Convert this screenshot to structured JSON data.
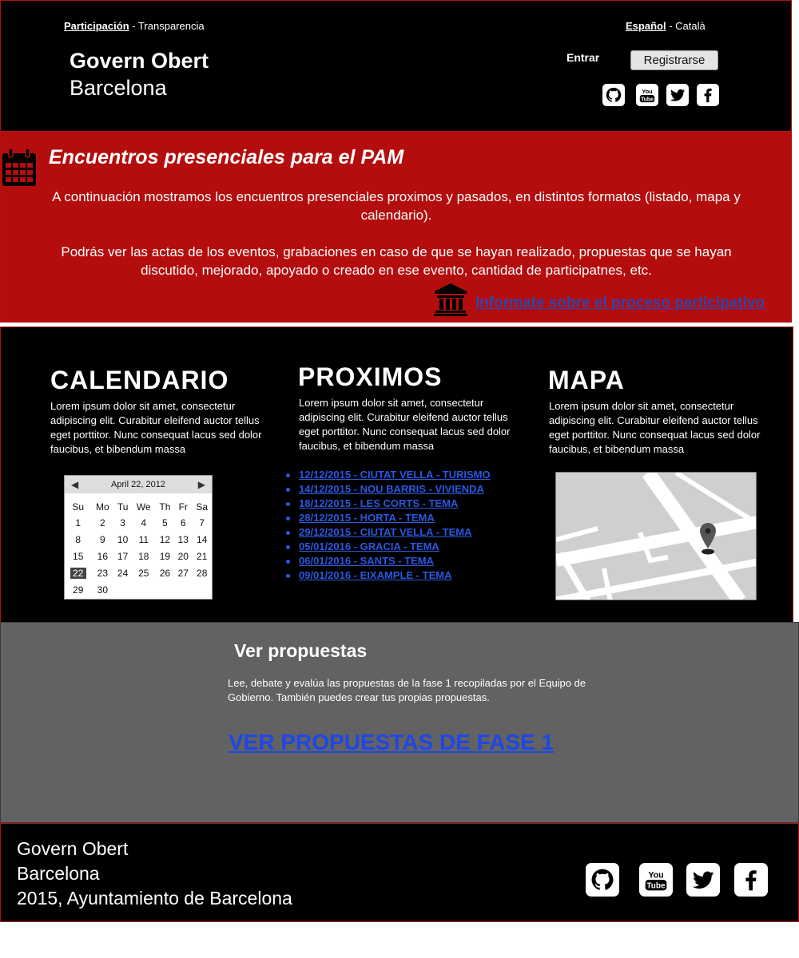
{
  "header": {
    "nav_left": {
      "active": "Participación",
      "separator": " - ",
      "other": "Transparencia"
    },
    "nav_right": {
      "active": "Español",
      "separator": " - ",
      "other": "Català"
    },
    "brand_line1": "Govern Obert",
    "brand_line2": "Barcelona",
    "login_label": "Entrar",
    "register_label": "Registrarse",
    "social_icons": [
      "github-icon",
      "youtube-icon",
      "twitter-icon",
      "facebook-icon"
    ]
  },
  "banner": {
    "title": "Encuentros presenciales para el PAM",
    "paragraph1": "A continuación mostramos los encuentros presenciales proximos y pasados, en distintos formatos (listado, mapa y calendario).",
    "paragraph2": "Podrás ver las actas de los eventos, grabaciones en caso de que se hayan realizado, propuestas que se hayan discutido, mejorado, apoyado o creado en ese evento, cantidad de participatnes, etc.",
    "link_label": "Informate sobre el proceso participativo",
    "background_color": "#b40d0d"
  },
  "calendar_col": {
    "title": "CALENDARIO",
    "text": "Lorem ipsum dolor sit amet, consectetur adipiscing elit. Curabitur eleifend auctor tellus eget porttitor. Nunc consequat lacus sed dolor faucibus, et bibendum massa",
    "widget": {
      "month_label": "April 22, 2012",
      "prev": "◀",
      "next": "▶",
      "weekdays": [
        "Su",
        "Mo",
        "Tu",
        "We",
        "Th",
        "Fr",
        "Sa"
      ],
      "weeks": [
        [
          "1",
          "2",
          "3",
          "4",
          "5",
          "6",
          "7"
        ],
        [
          "8",
          "9",
          "10",
          "11",
          "12",
          "13",
          "14"
        ],
        [
          "15",
          "16",
          "17",
          "18",
          "19",
          "20",
          "21"
        ],
        [
          "22",
          "23",
          "24",
          "25",
          "26",
          "27",
          "28"
        ],
        [
          "29",
          "30",
          "",
          "",
          "",
          "",
          ""
        ]
      ],
      "selected": "22"
    }
  },
  "proximos_col": {
    "title": "PROXIMOS",
    "text": "Lorem ipsum dolor sit amet, consectetur adipiscing elit. Curabitur eleifend auctor tellus eget porttitor. Nunc consequat lacus sed dolor faucibus, et bibendum massa",
    "events": [
      "12/12/2015 - CIUTAT VELLA - TURISMO",
      "14/12/2015 - NOU BARRIS - VIVIENDA",
      "18/12/2015 - LES CORTS - TEMA",
      "28/12/2015 - HORTA - TEMA",
      "29/12/2015 - CIUTAT VELLA - TEMA",
      "05/01/2016 - GRACIA - TEMA",
      "06/01/2016 - SANTS - TEMA",
      "09/01/2016 - EIXAMPLE - TEMA"
    ]
  },
  "mapa_col": {
    "title": "MAPA",
    "text": "Lorem ipsum dolor sit amet, consectetur adipiscing elit. Curabitur eleifend auctor tellus eget porttitor. Nunc consequat lacus sed dolor faucibus, et bibendum massa"
  },
  "proposals": {
    "title": "Ver propuestas",
    "text": "Lee, debate y evalúa las propuestas de la fase 1 recopiladas por el Equipo de Gobierno. También puedes crear tus propias propuestas.",
    "link_label": "VER PROPUESTAS DE FASE 1"
  },
  "footer": {
    "line1": "Govern Obert",
    "line2": "Barcelona",
    "line3": "2015, Ayuntamiento de Barcelona",
    "social_icons": [
      "github-icon",
      "youtube-icon",
      "twitter-icon",
      "facebook-icon"
    ]
  }
}
